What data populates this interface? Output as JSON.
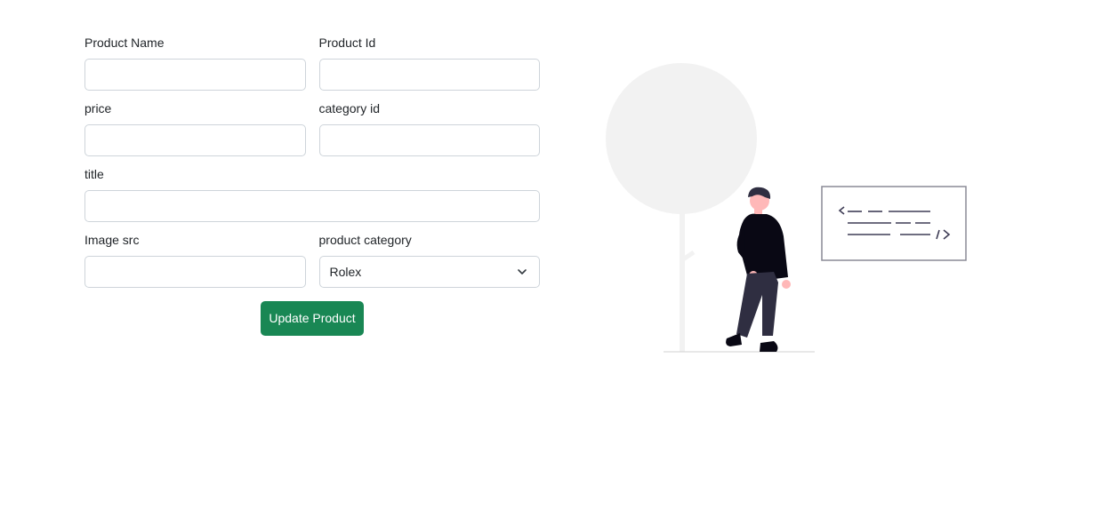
{
  "form": {
    "product_name": {
      "label": "Product Name",
      "value": ""
    },
    "product_id": {
      "label": "Product Id",
      "value": ""
    },
    "price": {
      "label": "price",
      "value": ""
    },
    "category_id": {
      "label": "category id",
      "value": ""
    },
    "title": {
      "label": "title",
      "value": ""
    },
    "image_src": {
      "label": "Image src",
      "value": ""
    },
    "product_category": {
      "label": "product category",
      "selected": "Rolex"
    },
    "submit_label": "Update Product"
  },
  "colors": {
    "button": "#198754",
    "input_border": "#ced4da",
    "illustration_circle": "#f2f2f2",
    "figure_dark": "#090814"
  },
  "illustration": {
    "name": "person-with-code-board-illustration",
    "code_symbols": "< />"
  }
}
